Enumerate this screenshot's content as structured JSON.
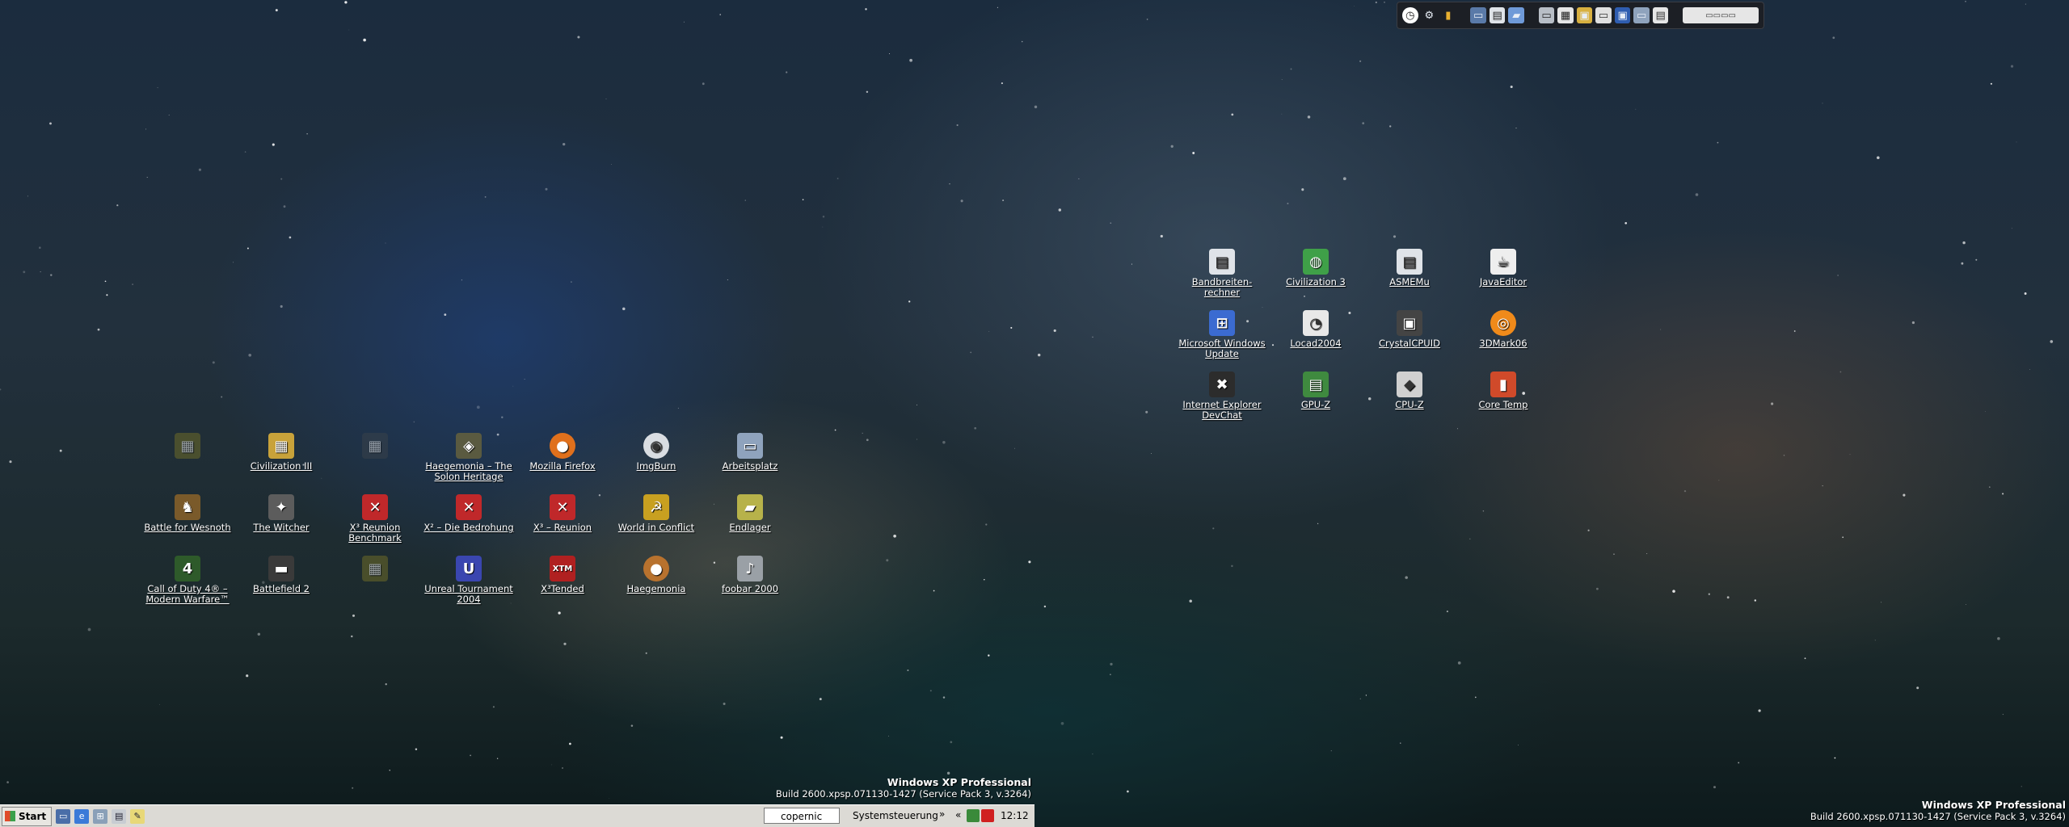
{
  "desktop_icons": [
    {
      "label": "",
      "faded": true,
      "icon": "game-icon",
      "color": "#6d6b28"
    },
    {
      "label": "Civilization III",
      "faded": false,
      "icon": "civ3-icon",
      "color": "#c8a23a"
    },
    {
      "label": "",
      "faded": true,
      "icon": "game-icon",
      "color": "#39424a"
    },
    {
      "label": "Haegemonia – The Solon Heritage",
      "faded": false,
      "icon": "haegemonia-icon",
      "color": "#5a5a40"
    },
    {
      "label": "Mozilla Firefox",
      "faded": false,
      "icon": "firefox-icon",
      "color": "#e0701c"
    },
    {
      "label": "ImgBurn",
      "faded": false,
      "icon": "disc-icon",
      "color": "#d9dde2"
    },
    {
      "label": "Arbeitsplatz",
      "faded": false,
      "icon": "computer-icon",
      "color": "#8fa3bd"
    },
    {
      "label": "Battle for Wesnoth",
      "faded": false,
      "icon": "wesnoth-icon",
      "color": "#7a5a2a"
    },
    {
      "label": "The Witcher",
      "faded": false,
      "icon": "witcher-icon",
      "color": "#5c5c5c"
    },
    {
      "label": "X³ Reunion Benchmark",
      "faded": false,
      "icon": "x3-icon",
      "color": "#c0282a"
    },
    {
      "label": "X² – Die Bedrohung",
      "faded": false,
      "icon": "x3-icon",
      "color": "#c0282a"
    },
    {
      "label": "X³ – Reunion",
      "faded": false,
      "icon": "x3-icon",
      "color": "#c0282a"
    },
    {
      "label": "World in Conflict",
      "faded": false,
      "icon": "wic-icon",
      "color": "#c8a020"
    },
    {
      "label": "Endlager",
      "faded": false,
      "icon": "folder-icon",
      "color": "#b7b24a"
    },
    {
      "label": "Call of Duty 4® – Modern Warfare™",
      "faded": false,
      "icon": "cod4-icon",
      "color": "#2e5a2a"
    },
    {
      "label": "Battlefield 2",
      "faded": false,
      "icon": "bf2-icon",
      "color": "#3a3a3a"
    },
    {
      "label": "",
      "faded": true,
      "icon": "game-icon",
      "color": "#6d6b28"
    },
    {
      "label": "Unreal Tournament 2004",
      "faded": false,
      "icon": "ut2004-icon",
      "color": "#3a46b0"
    },
    {
      "label": "X³Tended",
      "faded": false,
      "icon": "x3tended-icon",
      "color": "#b02020"
    },
    {
      "label": "Haegemonia",
      "faded": false,
      "icon": "planet-icon",
      "color": "#b8722e"
    },
    {
      "label": "foobar 2000",
      "faded": false,
      "icon": "foobar-icon",
      "color": "#9aa0a6"
    },
    {
      "label": "Bandbreiten-rechner",
      "faded": false,
      "icon": "document-icon",
      "color": "#dfe3e8"
    },
    {
      "label": "Civilization 3",
      "faded": false,
      "icon": "civ3-globe-icon",
      "color": "#3fa048"
    },
    {
      "label": "ASMEMu",
      "faded": false,
      "icon": "document-icon",
      "color": "#dfe3e8"
    },
    {
      "label": "JavaEditor",
      "faded": false,
      "icon": "java-icon",
      "color": "#eeeeee"
    },
    {
      "label": "Microsoft Windows Update",
      "faded": false,
      "icon": "windows-update-icon",
      "color": "#3b6bd1"
    },
    {
      "label": "Locad2004",
      "faded": false,
      "icon": "locad-icon",
      "color": "#e8e8e8"
    },
    {
      "label": "CrystalCPUID",
      "faded": false,
      "icon": "cpu-chip-icon",
      "color": "#444444"
    },
    {
      "label": "3DMark06",
      "faded": false,
      "icon": "3dmark-icon",
      "color": "#f08a1a"
    },
    {
      "label": "Internet Explorer DevChat",
      "faded": false,
      "icon": "ie-icon",
      "color": "#2c2c2c"
    },
    {
      "label": "GPU-Z",
      "faded": false,
      "icon": "gpuz-icon",
      "color": "#3f8a3f"
    },
    {
      "label": "CPU-Z",
      "faded": false,
      "icon": "cpuz-icon",
      "color": "#d0d0d0"
    },
    {
      "label": "Core Temp",
      "faded": false,
      "icon": "coretemp-icon",
      "color": "#d04a2a"
    }
  ],
  "watermark": {
    "left": {
      "edition": "Windows XP Professional",
      "build": "Build 2600.xpsp.071130-1427 (Service Pack 3, v.3264)"
    },
    "right": {
      "edition": "Windows XP Professional",
      "build": "Build 2600.xpsp.071130-1427 (Service Pack 3, v.3264)"
    }
  },
  "taskbar": {
    "start_label": "Start",
    "search_value": "copernic",
    "systemsteuerung_label": "Systemsteuerung",
    "chevron": "»",
    "collapse": "«",
    "clock": "12:12"
  },
  "toolbar_icons": [
    "clock-icon",
    "gear-icon",
    "chart-icon",
    "monitor-icon",
    "keyboard-icon",
    "folder-icon",
    "drive-icon",
    "calendar-icon",
    "window-icon",
    "window-icon",
    "window-icon",
    "display-icon",
    "window-icon",
    "taskbar-preview-icon"
  ]
}
